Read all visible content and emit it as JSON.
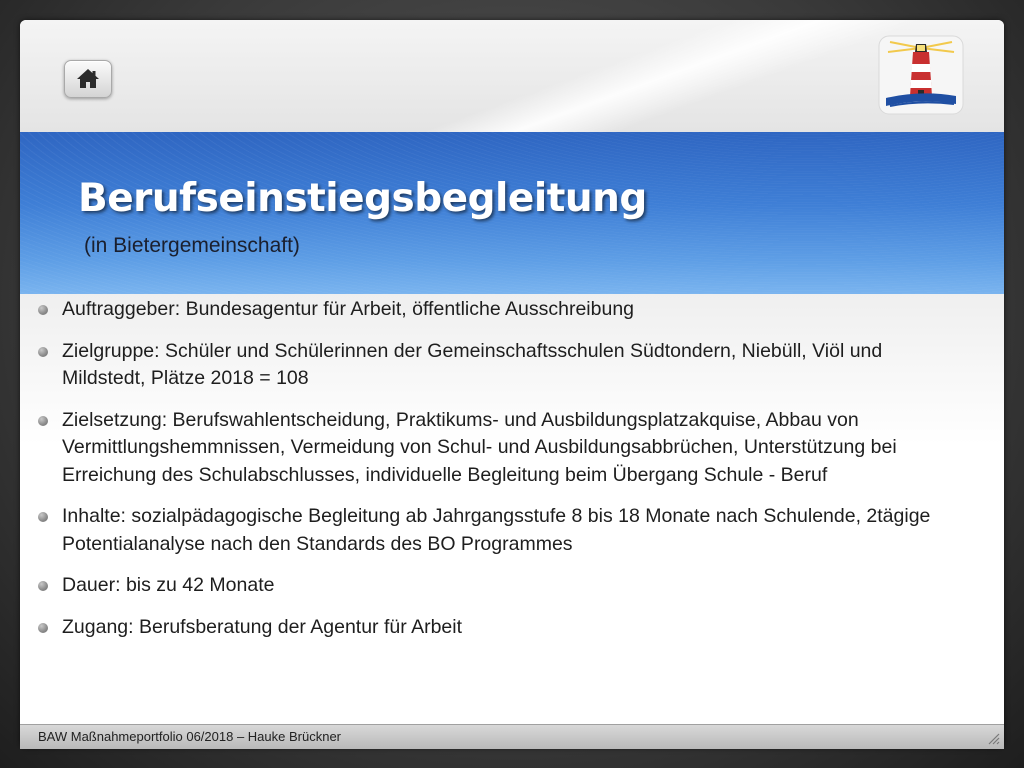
{
  "slide": {
    "title": "Berufseinstiegsbegleitung",
    "subtitle": "(in Bietergemeinschaft)"
  },
  "bullets": [
    "Auftraggeber: Bundesagentur für Arbeit, öffentliche Ausschreibung",
    "Zielgruppe: Schüler und Schülerinnen der Gemeinschaftsschulen Südtondern, Niebüll, Viöl und Mildstedt, Plätze 2018 = 108",
    "Zielsetzung: Berufswahlentscheidung, Praktikums- und Ausbildungsplatzakquise, Abbau von Vermittlungshemmnissen, Vermeidung von Schul- und Ausbildungsabbrüchen, Unterstützung bei Erreichung des Schulabschlusses, individuelle Begleitung beim Übergang Schule - Beruf",
    "Inhalte: sozialpädagogische Begleitung ab Jahrgangsstufe 8 bis 18 Monate nach Schulende, 2tägige Potentialanalyse nach den Standards des BO Programmes",
    "Dauer: bis zu  42 Monate",
    "Zugang: Berufsberatung der Agentur für Arbeit"
  ],
  "footer": {
    "text": "BAW Maßnahmeportfolio 06/2018 – Hauke Brückner"
  },
  "icons": {
    "home": "home-icon",
    "logo": "lighthouse-logo-icon",
    "bullet": "bullet-dot-icon",
    "resize": "resize-grip-icon"
  },
  "colors": {
    "title_band": "#3f7fd6",
    "title_text": "#ffffff",
    "body_text": "#1e1e1e"
  }
}
